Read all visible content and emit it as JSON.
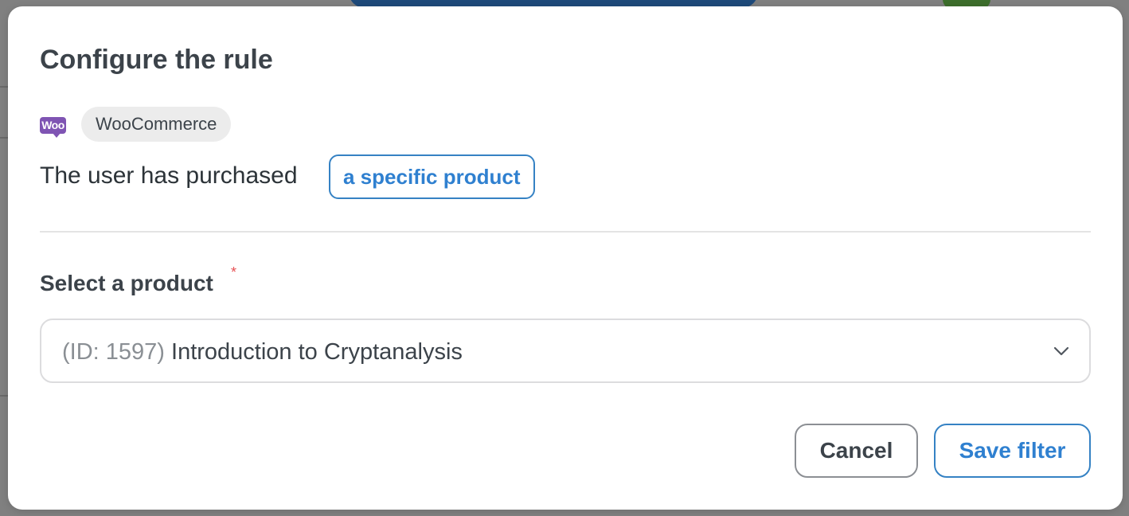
{
  "modal": {
    "title": "Configure the rule",
    "integration": {
      "icon": "woocommerce-logo-icon",
      "logo_text": "Woo",
      "label": "WooCommerce"
    },
    "condition": {
      "prefix": "The user has purchased",
      "selector_label": "a specific product"
    },
    "product_field": {
      "label": "Select a product",
      "required_mark": "*",
      "selected_id": "(ID: 1597)",
      "selected_name": "Introduction to Cryptanalysis",
      "dropdown_icon": "chevron-down-icon"
    },
    "actions": {
      "cancel_label": "Cancel",
      "save_label": "Save filter"
    }
  },
  "colors": {
    "accent": "#2f80d0",
    "woocommerce_purple": "#7f54b3",
    "required_red": "#e65054"
  }
}
